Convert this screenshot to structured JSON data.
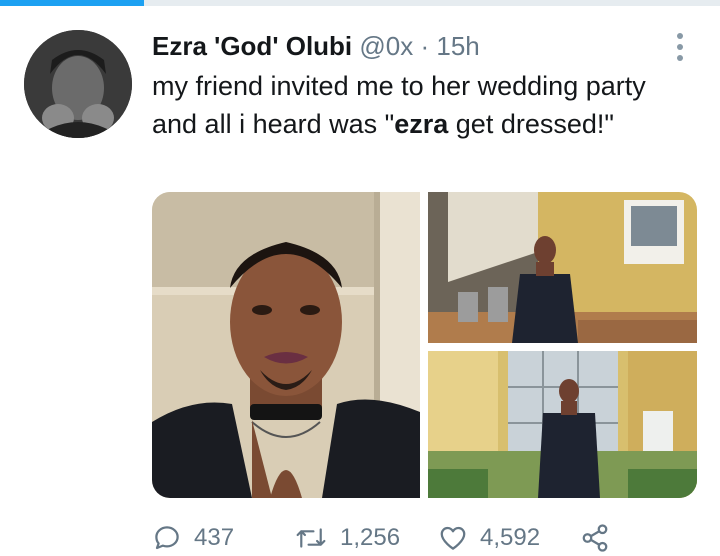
{
  "tweet": {
    "author_name": "Ezra 'God' Olubi",
    "handle": "@0x",
    "time": "15h",
    "separator": "·",
    "text_before": "my friend invited me to her wedding party and all i heard was \"",
    "text_bold": "ezra",
    "text_after": " get dressed!\""
  },
  "top_progress": 0.2,
  "actions": {
    "replies": "437",
    "retweets": "1,256",
    "likes": "4,592"
  },
  "icons": [
    "more-icon",
    "reply-icon",
    "retweet-icon",
    "like-icon",
    "share-icon"
  ],
  "colors": {
    "accent": "#1da1f2",
    "muted": "#657786"
  }
}
